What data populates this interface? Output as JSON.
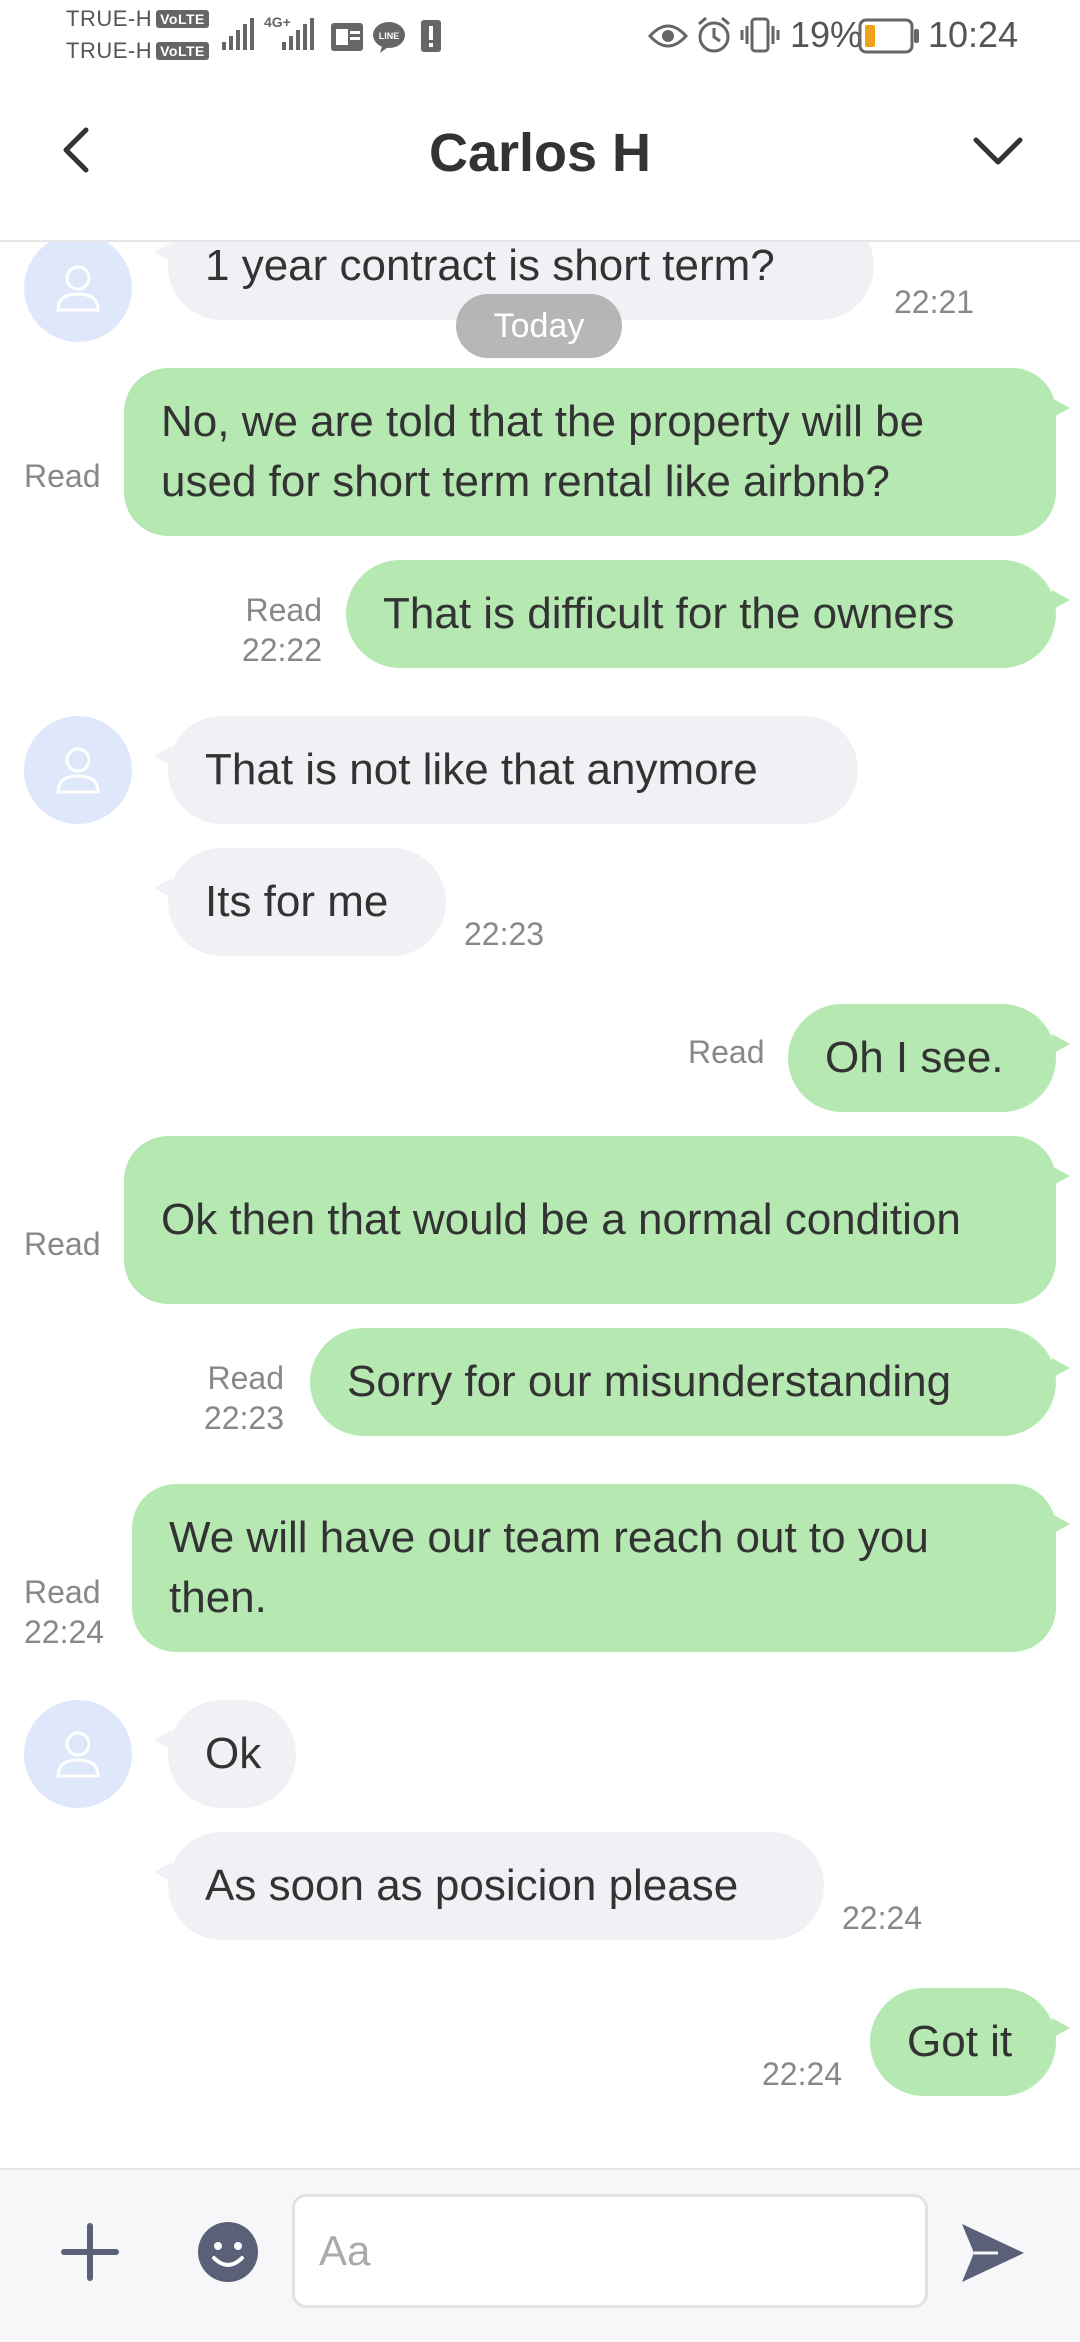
{
  "status_bar": {
    "carrier_1": "TRUE-H",
    "carrier_2": "TRUE-H",
    "volte_badge": "VoLTE",
    "network_type": "4G+",
    "battery_percent": "19%",
    "time": "10:24"
  },
  "header": {
    "title": "Carlos H",
    "back_icon": "chevron-left-icon",
    "expand_icon": "chevron-down-icon"
  },
  "chat": {
    "date_divider": "Today",
    "messages": [
      {
        "side": "in",
        "text": "1 year contract is short term?",
        "time": "22:21"
      },
      {
        "side": "out",
        "text": "No, we are told that the property will be used for short term rental like airbnb?",
        "status": "Read"
      },
      {
        "side": "out",
        "text": "That is difficult for the owners",
        "status": "Read",
        "time": "22:22"
      },
      {
        "side": "in",
        "text": "That is not like that anymore"
      },
      {
        "side": "in",
        "text": "Its for me",
        "time": "22:23"
      },
      {
        "side": "out",
        "text": "Oh I see.",
        "status": "Read"
      },
      {
        "side": "out",
        "text": "Ok then that would be a normal condition",
        "status": "Read"
      },
      {
        "side": "out",
        "text": "Sorry for our misunderstanding",
        "status": "Read",
        "time": "22:23"
      },
      {
        "side": "out",
        "text": "We will have our team reach out to you then.",
        "status": "Read",
        "time": "22:24"
      },
      {
        "side": "in",
        "text": "Ok"
      },
      {
        "side": "in",
        "text": "As soon as posicion please",
        "time": "22:24"
      },
      {
        "side": "out",
        "text": "Got it",
        "time": "22:24"
      }
    ]
  },
  "input_bar": {
    "placeholder": "Aa",
    "value": "",
    "add_icon": "plus-icon",
    "emoji_icon": "smiley-icon",
    "send_icon": "send-icon"
  },
  "colors": {
    "outgoing_bubble": "#b6e8b1",
    "incoming_bubble": "#f0f1f4",
    "avatar_bg": "#dfe7fb",
    "icon_gray": "#5a6078"
  }
}
